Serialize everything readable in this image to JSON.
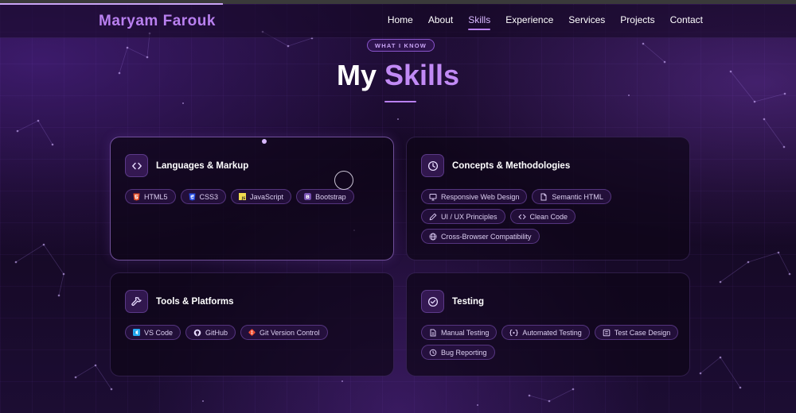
{
  "brand": "Maryam Farouk",
  "nav": [
    "Home",
    "About",
    "Skills",
    "Experience",
    "Services",
    "Projects",
    "Contact"
  ],
  "nav_active": "Skills",
  "reading_progress_fraction": 0.28,
  "section": {
    "eyebrow": "WHAT I KNOW",
    "title_plain": "My",
    "title_accent": "Skills"
  },
  "cards": [
    {
      "title": "Languages & Markup",
      "icon": "code-icon",
      "chips": [
        {
          "label": "HTML5",
          "icon": "html5-icon"
        },
        {
          "label": "CSS3",
          "icon": "css3-icon"
        },
        {
          "label": "JavaScript",
          "icon": "javascript-icon"
        },
        {
          "label": "Bootstrap",
          "icon": "bootstrap-icon"
        }
      ]
    },
    {
      "title": "Concepts & Methodologies",
      "icon": "clock-icon",
      "chips": [
        {
          "label": "Responsive Web Design",
          "icon": "monitor-icon"
        },
        {
          "label": "Semantic HTML",
          "icon": "file-icon"
        },
        {
          "label": "UI / UX Principles",
          "icon": "pen-icon"
        },
        {
          "label": "Clean Code",
          "icon": "code-icon"
        },
        {
          "label": "Cross-Browser Compatibility",
          "icon": "globe-icon"
        }
      ]
    },
    {
      "title": "Tools & Platforms",
      "icon": "wrench-icon",
      "chips": [
        {
          "label": "VS Code",
          "icon": "vscode-icon"
        },
        {
          "label": "GitHub",
          "icon": "github-icon"
        },
        {
          "label": "Git Version Control",
          "icon": "git-icon"
        }
      ]
    },
    {
      "title": "Testing",
      "icon": "check-circle-icon",
      "chips": [
        {
          "label": "Manual Testing",
          "icon": "document-icon"
        },
        {
          "label": "Automated Testing",
          "icon": "code-braces-icon"
        },
        {
          "label": "Test Case Design",
          "icon": "checklist-icon"
        },
        {
          "label": "Bug Reporting",
          "icon": "bug-icon"
        }
      ]
    }
  ],
  "colors": {
    "accent": "#b980f0",
    "accent_light": "#c18af5",
    "background": "#140822",
    "html5": "#e44d26",
    "css3": "#264de4",
    "javascript": "#f0db4f",
    "bootstrap": "#7952b3",
    "vscode": "#23a9f2",
    "git": "#f05033"
  }
}
